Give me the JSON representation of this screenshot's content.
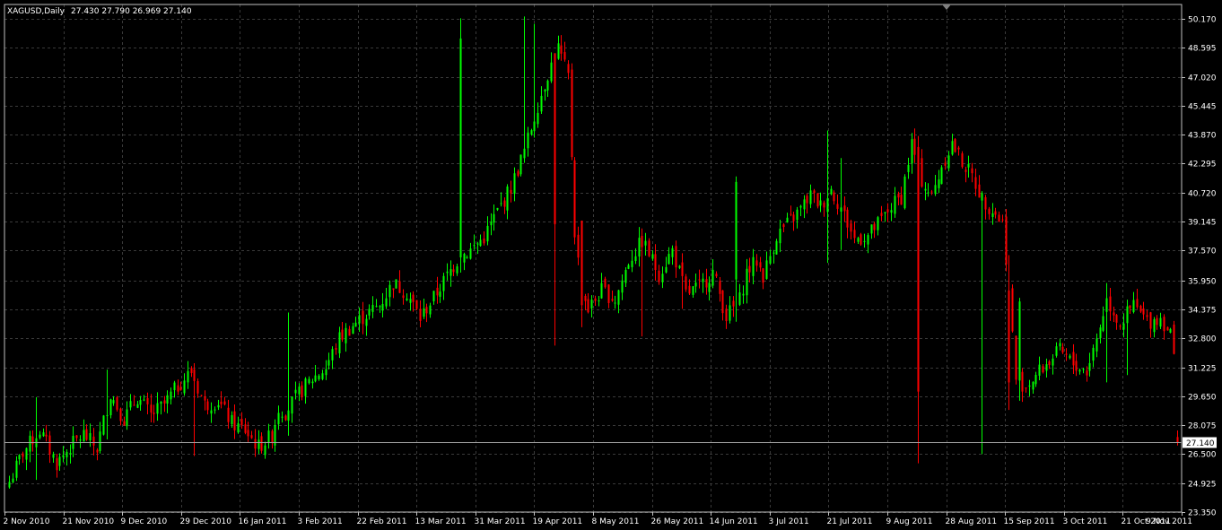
{
  "header": {
    "symbol_timeframe": "XAGUSD,Daily",
    "ohlc": "27.430 27.790 26.969 27.140"
  },
  "colors": {
    "background": "#000000",
    "grid": "#3a3a3a",
    "axis": "#c0c0c0",
    "bull": "#00ff00",
    "bear": "#ff0000",
    "text": "#ffffff",
    "price_line": "#a0a0a0"
  },
  "chart_data": {
    "type": "candlestick",
    "title": "XAGUSD,Daily",
    "ylim": [
      23.35,
      50.95
    ],
    "y_ticks": [
      50.17,
      48.595,
      47.02,
      45.445,
      43.87,
      42.295,
      40.72,
      39.145,
      37.57,
      35.95,
      34.375,
      32.8,
      31.225,
      29.65,
      28.075,
      26.5,
      24.925,
      23.35
    ],
    "y_tick_labels": [
      "50.170",
      "48.595",
      "47.020",
      "45.445",
      "43.870",
      "42.295",
      "40.720",
      "39.145",
      "37.570",
      "35.950",
      "34.375",
      "32.800",
      "31.225",
      "29.650",
      "28.075",
      "26.500",
      "24.925",
      "23.350"
    ],
    "x_tick_labels": [
      "2 Nov 2010",
      "21 Nov 2010",
      "9 Dec 2010",
      "29 Dec 2010",
      "16 Jan 2011",
      "3 Feb 2011",
      "22 Feb 2011",
      "13 Mar 2011",
      "31 Mar 2011",
      "19 Apr 2011",
      "8 May 2011",
      "26 May 2011",
      "14 Jun 2011",
      "3 Jul 2011",
      "21 Jul 2011",
      "9 Aug 2011",
      "28 Aug 2011",
      "15 Sep 2011",
      "3 Oct 2011",
      "21 Oct 2011",
      "9 Nov 2011"
    ],
    "current_price": 27.14,
    "current_price_label": "27.140",
    "grid": true,
    "close_path": [
      [
        0,
        25.0
      ],
      [
        4,
        26.6
      ],
      [
        9,
        27.8
      ],
      [
        14,
        26.0
      ],
      [
        18,
        26.9
      ],
      [
        22,
        27.6
      ],
      [
        26,
        26.8
      ],
      [
        30,
        29.8
      ],
      [
        34,
        28.4
      ],
      [
        38,
        29.6
      ],
      [
        42,
        28.6
      ],
      [
        46,
        29.2
      ],
      [
        50,
        30.2
      ],
      [
        54,
        31.0
      ],
      [
        58,
        29.2
      ],
      [
        62,
        29.4
      ],
      [
        66,
        28.2
      ],
      [
        70,
        27.8
      ],
      [
        74,
        26.9
      ],
      [
        78,
        27.5
      ],
      [
        80,
        29.0
      ],
      [
        82,
        28.8
      ],
      [
        86,
        29.8
      ],
      [
        90,
        30.6
      ],
      [
        94,
        31.2
      ],
      [
        98,
        32.8
      ],
      [
        102,
        33.5
      ],
      [
        106,
        34.1
      ],
      [
        110,
        34.6
      ],
      [
        114,
        35.8
      ],
      [
        118,
        35.3
      ],
      [
        122,
        33.9
      ],
      [
        126,
        35.0
      ],
      [
        130,
        36.2
      ],
      [
        134,
        37.3
      ],
      [
        137,
        37.6
      ],
      [
        141,
        38.3
      ],
      [
        145,
        39.7
      ],
      [
        149,
        41.0
      ],
      [
        153,
        43.0
      ],
      [
        157,
        45.5
      ],
      [
        160,
        47.2
      ],
      [
        163,
        48.6
      ],
      [
        166,
        47.0
      ],
      [
        168,
        38.6
      ],
      [
        170,
        35.4
      ],
      [
        172,
        34.4
      ],
      [
        176,
        35.4
      ],
      [
        180,
        34.9
      ],
      [
        184,
        37.0
      ],
      [
        188,
        38.1
      ],
      [
        190,
        37.4
      ],
      [
        193,
        36.3
      ],
      [
        197,
        37.6
      ],
      [
        201,
        35.2
      ],
      [
        205,
        35.6
      ],
      [
        209,
        36.4
      ],
      [
        213,
        34.0
      ],
      [
        217,
        34.9
      ],
      [
        219,
        36.4
      ],
      [
        222,
        37.0
      ],
      [
        224,
        36.2
      ],
      [
        228,
        38.4
      ],
      [
        231,
        39.0
      ],
      [
        234,
        39.6
      ],
      [
        238,
        40.6
      ],
      [
        241,
        40.0
      ],
      [
        244,
        40.9
      ],
      [
        247,
        39.9
      ],
      [
        251,
        38.2
      ],
      [
        255,
        38.4
      ],
      [
        259,
        39.2
      ],
      [
        262,
        40.0
      ],
      [
        265,
        40.5
      ],
      [
        268,
        43.4
      ],
      [
        271,
        41.4
      ],
      [
        274,
        40.5
      ],
      [
        277,
        42.2
      ],
      [
        280,
        43.4
      ],
      [
        283,
        42.4
      ],
      [
        286,
        41.6
      ],
      [
        289,
        40.4
      ],
      [
        292,
        39.8
      ],
      [
        295,
        39.1
      ],
      [
        297,
        35.4
      ],
      [
        299,
        30.6
      ],
      [
        302,
        30.2
      ],
      [
        305,
        30.8
      ],
      [
        308,
        31.4
      ],
      [
        312,
        32.1
      ],
      [
        316,
        31.4
      ],
      [
        320,
        31.0
      ],
      [
        323,
        32.8
      ],
      [
        326,
        34.9
      ],
      [
        330,
        33.6
      ],
      [
        334,
        34.6
      ],
      [
        338,
        33.7
      ],
      [
        342,
        33.9
      ],
      [
        345,
        33.1
      ],
      [
        346,
        31.7
      ],
      [
        347,
        27.14
      ]
    ],
    "spikes": [
      [
        8,
        29.6,
        25.1
      ],
      [
        29,
        31.1,
        27.3
      ],
      [
        55,
        31.4,
        26.4
      ],
      [
        83,
        34.2,
        27.5
      ],
      [
        134,
        50.2,
        37.2
      ],
      [
        153,
        50.3,
        44.8
      ],
      [
        156,
        49.9,
        45.4
      ],
      [
        162,
        48.2,
        32.4
      ],
      [
        170,
        39.2,
        33.4
      ],
      [
        188,
        38.7,
        32.9
      ],
      [
        200,
        36.4,
        34.4
      ],
      [
        216,
        41.6,
        33.7
      ],
      [
        243,
        44.1,
        36.9
      ],
      [
        247,
        42.6,
        37.6
      ],
      [
        270,
        43.8,
        26.0
      ],
      [
        289,
        39.6,
        26.5
      ],
      [
        297,
        35.6,
        28.9
      ],
      [
        300,
        35.0,
        29.4
      ],
      [
        326,
        35.8,
        30.4
      ],
      [
        332,
        34.9,
        30.8
      ]
    ],
    "big_bars": [
      [
        134,
        37.2,
        49.1
      ],
      [
        162,
        48.3,
        39.0
      ],
      [
        170,
        39.2,
        34.6
      ],
      [
        216,
        36.0,
        41.3
      ],
      [
        270,
        43.2,
        29.9
      ],
      [
        297,
        35.4,
        30.4
      ],
      [
        300,
        30.5,
        34.8
      ]
    ]
  }
}
